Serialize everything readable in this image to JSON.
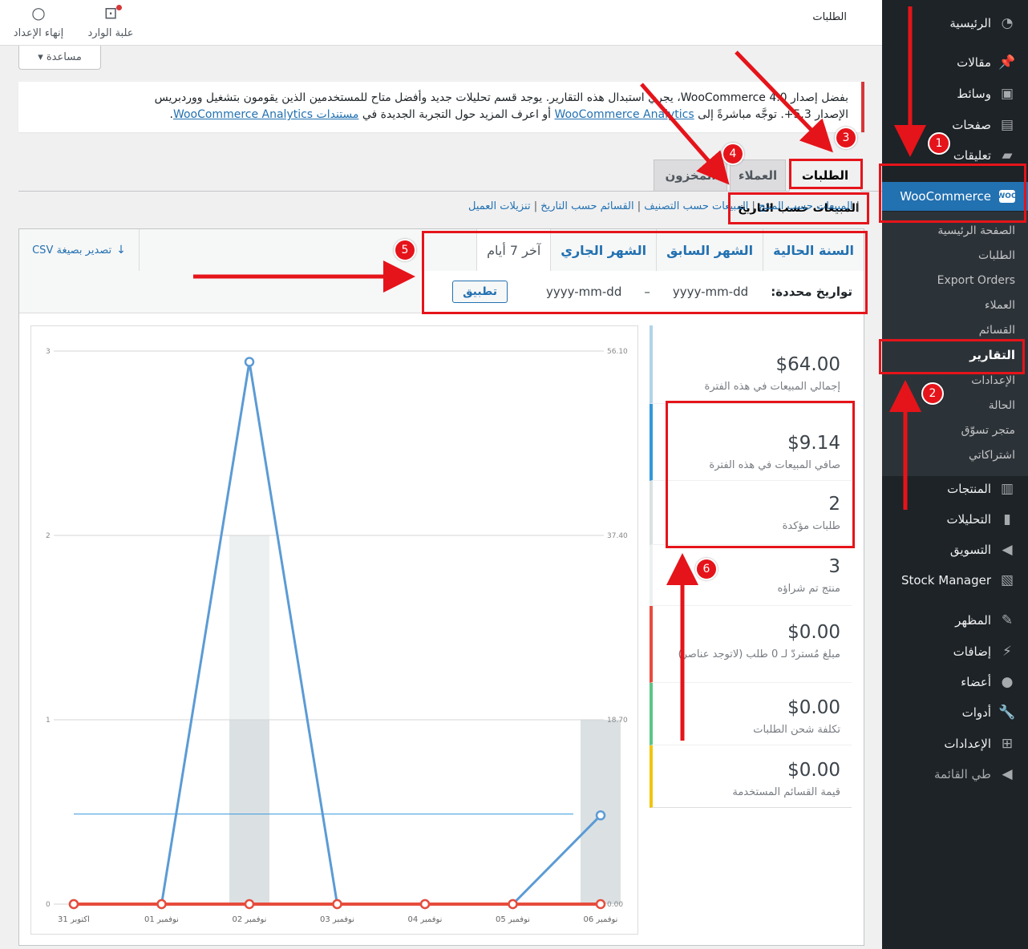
{
  "header": {
    "page_title": "الطلبات",
    "inbox_label": "علبة الوارد",
    "finish_setup_label": "إنهاء الإعداد",
    "help_label": "مساعدة"
  },
  "sidebar": {
    "items": [
      {
        "label": "الرئيسية",
        "icon": "dashboard-icon"
      },
      {
        "label": "مقالات",
        "icon": "pin-icon"
      },
      {
        "label": "وسائط",
        "icon": "media-icon"
      },
      {
        "label": "صفحات",
        "icon": "page-icon"
      },
      {
        "label": "تعليقات",
        "icon": "comment-icon"
      },
      {
        "label": "WooCommerce",
        "icon": "woo-icon"
      }
    ],
    "woo_badge": "WOO",
    "submenu": [
      "الصفحة الرئيسية",
      "الطلبات",
      "Export Orders",
      "العملاء",
      "القسائم",
      "التقارير",
      "الإعدادات",
      "الحالة",
      "متجر تسوّق",
      "اشتراكاتي"
    ],
    "lower_items": [
      {
        "label": "المنتجات",
        "icon": "archive-icon"
      },
      {
        "label": "التحليلات",
        "icon": "chart-icon"
      },
      {
        "label": "التسويق",
        "icon": "megaphone-icon"
      },
      {
        "label": "Stock Manager",
        "icon": "book-icon"
      },
      {
        "label": "المظهر",
        "icon": "brush-icon"
      },
      {
        "label": "إضافات",
        "icon": "plugin-icon"
      },
      {
        "label": "أعضاء",
        "icon": "user-icon"
      },
      {
        "label": "أدوات",
        "icon": "wrench-icon"
      },
      {
        "label": "الإعدادات",
        "icon": "settings-icon"
      },
      {
        "label": "طي القائمة",
        "icon": "collapse-icon"
      }
    ]
  },
  "notice": {
    "line1": "بفضل إصدار WooCommerce 4.0، يجري استبدال هذه التقارير. يوجد قسم تحليلات جديد وأفضل متاح للمستخدمين الذين يقومون بتشغيل ووردبريس",
    "line2_pre": "الإصدار 5.3+. توجَّه مباشرةً إلى ",
    "link1": "WooCommerce Analytics",
    "line2_mid": " أو اعرف المزيد حول التجربة الجديدة في ",
    "link2": "مستندات WooCommerce Analytics",
    "line2_end": "."
  },
  "tabs": [
    "الطلبات",
    "العملاء",
    "المخزون"
  ],
  "subtabs": {
    "current": "المبيعات حسب التاريخ",
    "links": [
      "المبيعات حسب المنتج",
      "المبيعات حسب التصنيف",
      "القسائم حسب التاريخ",
      "تنزيلات العميل"
    ]
  },
  "range": {
    "tabs": [
      "السنة الحالية",
      "الشهر السابق",
      "الشهر الجاري",
      "آخر 7 أيام"
    ],
    "custom_label": "تواريخ محددة:",
    "from_placeholder": "yyyy-mm-dd",
    "separator": "–",
    "to_placeholder": "yyyy-mm-dd",
    "apply_label": "تطبيق",
    "export_label": "تصدير بصيغة CSV"
  },
  "legend": [
    {
      "amount": "$64.00",
      "desc": "إجمالي المبيعات في هذه الفترة",
      "color": "#b1d4ea"
    },
    {
      "amount": "$9.14",
      "desc": "صافي المبيعات في هذه الفترة",
      "color": "#3498db"
    },
    {
      "amount": "2",
      "desc": "طلبات مؤكدة",
      "color": "#dbe1e3"
    },
    {
      "amount": "3",
      "desc": "منتج تم شراؤه",
      "color": "#ecf0f1"
    },
    {
      "amount": "$0.00",
      "desc": "مبلغ مُستردّ لـ 0 طلب (لاتوجد عناصر)",
      "color": "#e74c3c"
    },
    {
      "amount": "$0.00",
      "desc": "تكلفة شحن الطلبات",
      "color": "#5cc488"
    },
    {
      "amount": "$0.00",
      "desc": "قيمة القسائم المستخدمة",
      "color": "#f1c40f"
    }
  ],
  "chart_data": {
    "type": "line",
    "categories": [
      "31 اكتوبر",
      "01 نوفمبر",
      "02 نوفمبر",
      "03 نوفمبر",
      "04 نوفمبر",
      "05 نوفمبر",
      "06 نوفمبر"
    ],
    "left_axis_ticks": [
      "0",
      "1",
      "2",
      "3"
    ],
    "right_axis_ticks": [
      "0.00",
      "18.70",
      "37.40",
      "56.10"
    ],
    "series": [
      {
        "values": [
          0,
          0,
          55,
          0,
          0,
          0,
          9
        ],
        "color": "#5b9bd5"
      },
      {
        "values": [
          0,
          0,
          0,
          0,
          0,
          0,
          0
        ],
        "color": "#e74c3c"
      }
    ],
    "bars": [
      0,
      0,
      2,
      0,
      0,
      0,
      1
    ],
    "average_line": 9.14
  },
  "annotations": [
    "1",
    "2",
    "3",
    "4",
    "5",
    "6"
  ]
}
